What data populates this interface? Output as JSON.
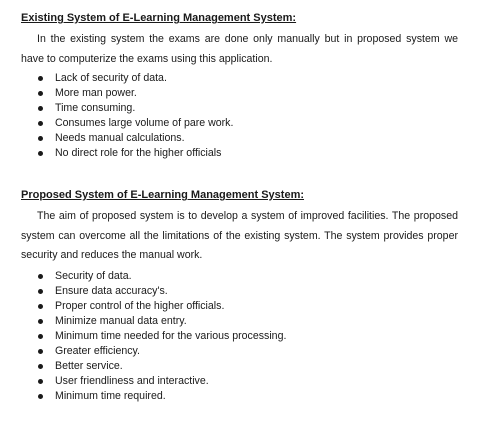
{
  "existing": {
    "heading": "Existing System of E-Learning Management System:",
    "paragraph": "In the existing system the exams are done only manually but in proposed system we have to computerize the exams using this application.",
    "bullets": [
      "Lack of security of data.",
      "More man power.",
      "Time consuming.",
      "Consumes large volume of pare work.",
      "Needs manual calculations.",
      "No direct role for the higher officials"
    ]
  },
  "proposed": {
    "heading": "Proposed System of E-Learning Management System:",
    "paragraph": "The aim of proposed system is to develop a system of improved facilities. The proposed system can overcome all the limitations of the existing system. The system provides proper security and reduces the manual work.",
    "bullets": [
      "Security of data.",
      "Ensure data accuracy's.",
      "Proper control of the higher officials.",
      "Minimize manual data entry.",
      "Minimum time needed for the various processing.",
      "Greater efficiency.",
      "Better service.",
      "User friendliness and interactive.",
      "Minimum time required."
    ]
  }
}
